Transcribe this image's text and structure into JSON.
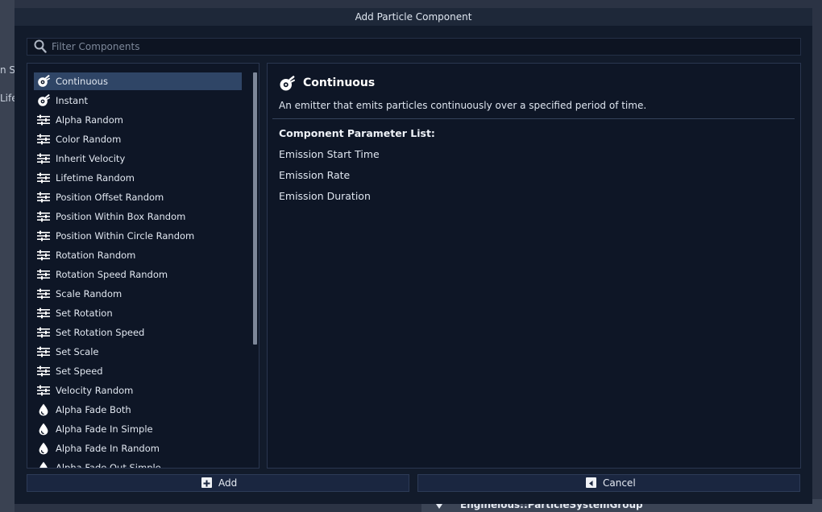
{
  "background": {
    "left_fragments": [
      "n Sp",
      "Life"
    ],
    "bottom_label": "Engineious::ParticleSystemGroup"
  },
  "dialog": {
    "title": "Add Particle Component",
    "filter_placeholder": "Filter Components",
    "components": [
      {
        "label": "Continuous",
        "icon": "emitter-icon",
        "selected": true
      },
      {
        "label": "Instant",
        "icon": "emitter-icon"
      },
      {
        "label": "Alpha Random",
        "icon": "sliders-icon"
      },
      {
        "label": "Color Random",
        "icon": "sliders-icon"
      },
      {
        "label": "Inherit Velocity",
        "icon": "sliders-icon"
      },
      {
        "label": "Lifetime Random",
        "icon": "sliders-icon"
      },
      {
        "label": "Position Offset Random",
        "icon": "sliders-icon"
      },
      {
        "label": "Position Within Box Random",
        "icon": "sliders-icon"
      },
      {
        "label": "Position Within Circle Random",
        "icon": "sliders-icon"
      },
      {
        "label": "Rotation Random",
        "icon": "sliders-icon"
      },
      {
        "label": "Rotation Speed Random",
        "icon": "sliders-icon"
      },
      {
        "label": "Scale Random",
        "icon": "sliders-icon"
      },
      {
        "label": "Set Rotation",
        "icon": "sliders-icon"
      },
      {
        "label": "Set Rotation Speed",
        "icon": "sliders-icon"
      },
      {
        "label": "Set Scale",
        "icon": "sliders-icon"
      },
      {
        "label": "Set Speed",
        "icon": "sliders-icon"
      },
      {
        "label": "Velocity Random",
        "icon": "sliders-icon"
      },
      {
        "label": "Alpha Fade Both",
        "icon": "drop-icon"
      },
      {
        "label": "Alpha Fade In Simple",
        "icon": "drop-icon"
      },
      {
        "label": "Alpha Fade In Random",
        "icon": "drop-icon"
      },
      {
        "label": "Alpha Fade Out Simple",
        "icon": "drop-icon"
      }
    ],
    "detail": {
      "title": "Continuous",
      "icon": "emitter-icon",
      "description": "An emitter that emits particles continuously over a specified period of time.",
      "param_header": "Component Parameter List:",
      "params": [
        "Emission Start Time",
        "Emission Rate",
        "Emission Duration"
      ]
    },
    "add_label": "Add",
    "cancel_label": "Cancel"
  },
  "colors": {
    "dialog_bg": "#121b2b",
    "selection": "#2f4566",
    "text": "#dfe6f0"
  }
}
